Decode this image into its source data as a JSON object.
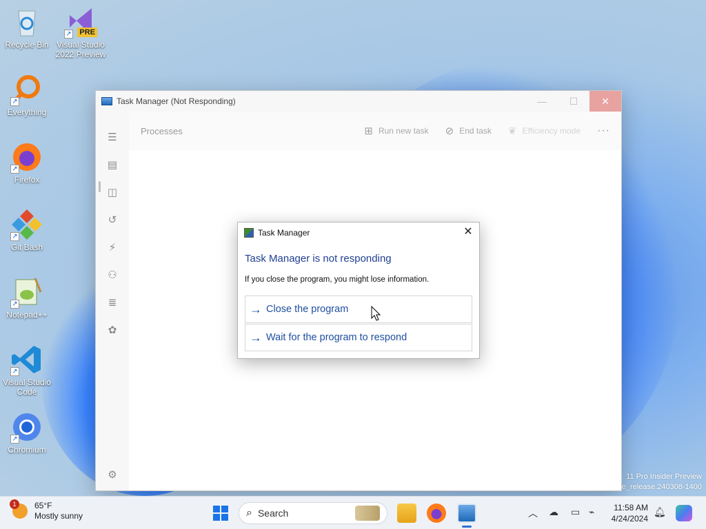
{
  "desktop": {
    "icons": [
      {
        "label": "Recycle Bin"
      },
      {
        "label": "Visual Studio 2022 Preview",
        "badge": "PRE"
      },
      {
        "label": "Everything"
      },
      {
        "label": "Firefox"
      },
      {
        "label": "Git Bash"
      },
      {
        "label": "Notepad++"
      },
      {
        "label": "Visual Studio Code"
      },
      {
        "label": "Chromium"
      }
    ],
    "watermark_line1": "11 Pro Insider Preview",
    "watermark_line2": "e_release.240308-1400"
  },
  "task_manager": {
    "title": "Task Manager (Not Responding)",
    "page_title": "Processes",
    "toolbar": {
      "run_new_task": "Run new task",
      "end_task": "End task",
      "efficiency_mode": "Efficiency mode",
      "more": "···"
    }
  },
  "dialog": {
    "title": "Task Manager",
    "heading": "Task Manager is not responding",
    "message": "If you close the program, you might lose information.",
    "option_close": "Close the program",
    "option_wait": "Wait for the program to respond",
    "arrow": "→",
    "close_glyph": "✕"
  },
  "taskbar": {
    "weather_temp": "65°F",
    "weather_desc": "Mostly sunny",
    "weather_badge": "1",
    "search_placeholder": "Search",
    "time": "11:58 AM",
    "date": "4/24/2024"
  },
  "colors": {
    "accent": "#1f4fa0",
    "close_hover": "#e8a3a0"
  }
}
